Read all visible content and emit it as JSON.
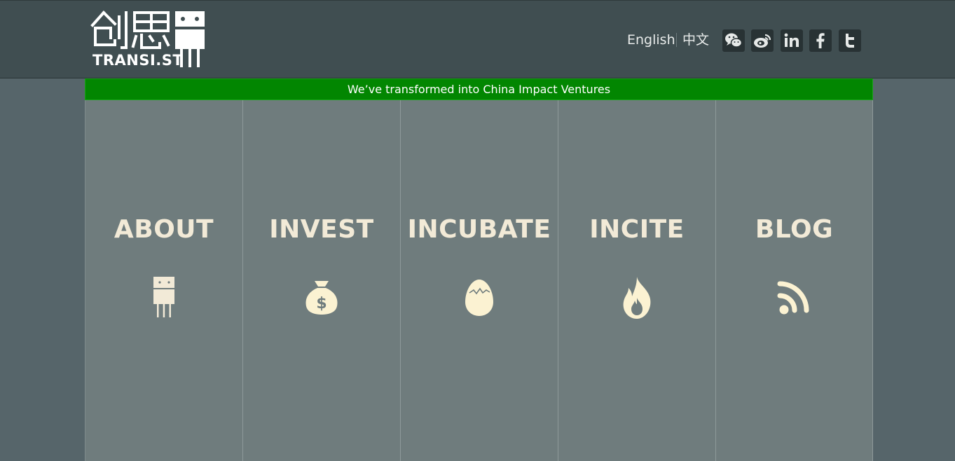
{
  "header": {
    "logo": {
      "chinese": "创思",
      "text": "TRANSI.ST"
    },
    "languages": [
      {
        "label": "English"
      },
      {
        "label": "中文"
      }
    ],
    "social": [
      {
        "icon": "wechat-icon"
      },
      {
        "icon": "weibo-icon"
      },
      {
        "icon": "linkedin-icon"
      },
      {
        "icon": "facebook-icon"
      },
      {
        "icon": "twitter-icon"
      }
    ]
  },
  "banner": {
    "text": "We’ve transformed into China Impact Ventures",
    "color": "#028601"
  },
  "panels": [
    {
      "title": "ABOUT",
      "icon": "transistor-icon"
    },
    {
      "title": "INVEST",
      "icon": "money-bag-icon"
    },
    {
      "title": "INCUBATE",
      "icon": "cracked-egg-icon"
    },
    {
      "title": "INCITE",
      "icon": "flame-icon"
    },
    {
      "title": "BLOG",
      "icon": "rss-icon"
    }
  ],
  "colors": {
    "header": "#404e51",
    "page": "#56656a",
    "panel": "#6f7c7d",
    "panel_text": "#f2ead7"
  }
}
